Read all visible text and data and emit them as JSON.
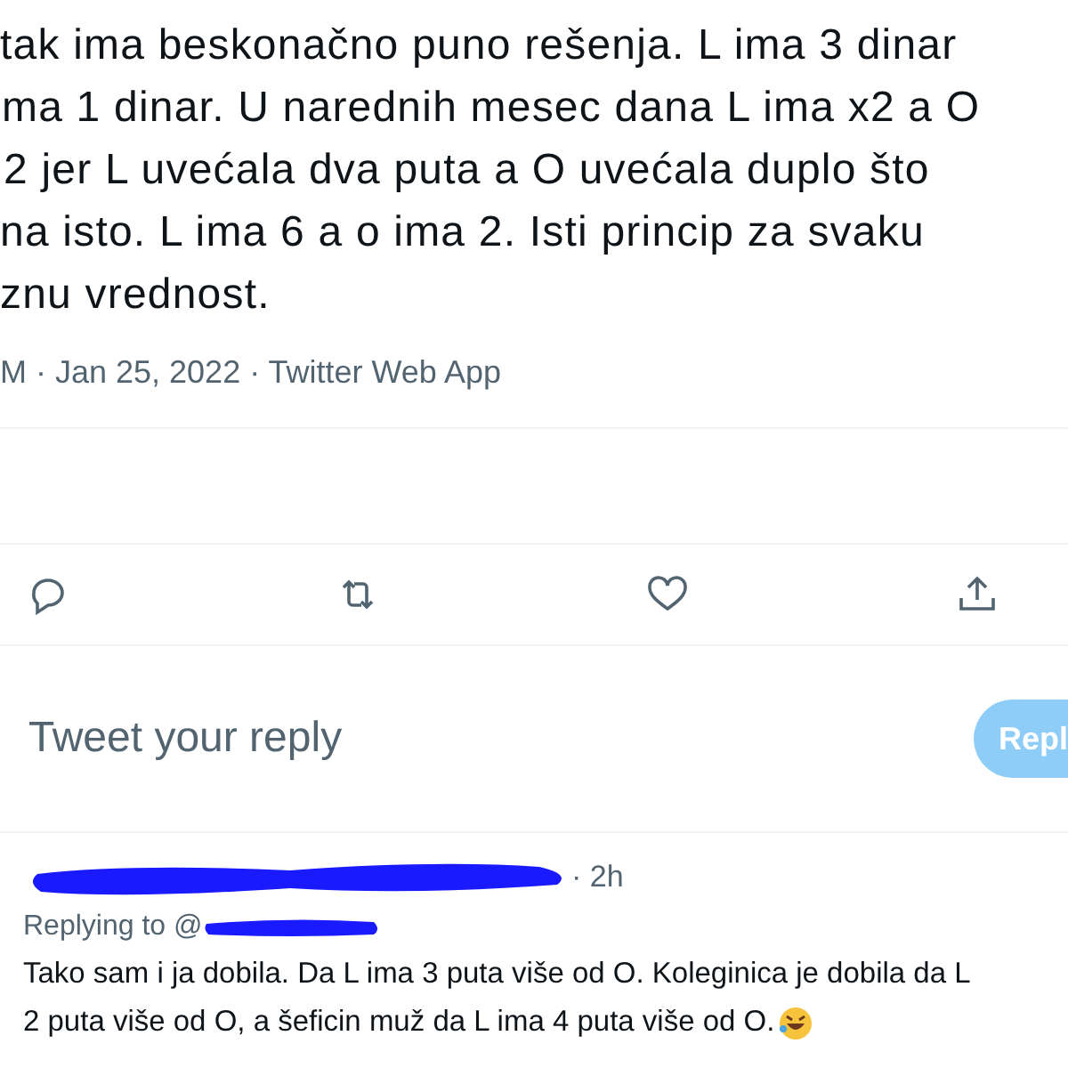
{
  "tweet": {
    "lines": [
      "tak ima beskonačno puno rešenja. L ima 3 dinar",
      "ma 1 dinar. U narednih mesec dana L ima x2 a O",
      "2 jer L uvećala dva puta a O uvećala duplo što",
      "na isto. L ima 6 a o ima 2. Isti princip za svaku",
      "znu vrednost."
    ],
    "meta": "M · Jan 25, 2022 · Twitter Web App"
  },
  "actions": [
    {
      "kind": "reply"
    },
    {
      "kind": "retweet"
    },
    {
      "kind": "like"
    },
    {
      "kind": "share"
    }
  ],
  "compose": {
    "placeholder": "Tweet your reply",
    "button": "Repl"
  },
  "reply": {
    "time": "· 2h",
    "replying_to": "Replying to @",
    "lines": [
      "Tako sam i ja dobila. Da L ima 3 puta više od O. Koleginica je dobila da L",
      "2 puta više od O, a šeficin muž da L ima 4 puta više od O."
    ]
  }
}
